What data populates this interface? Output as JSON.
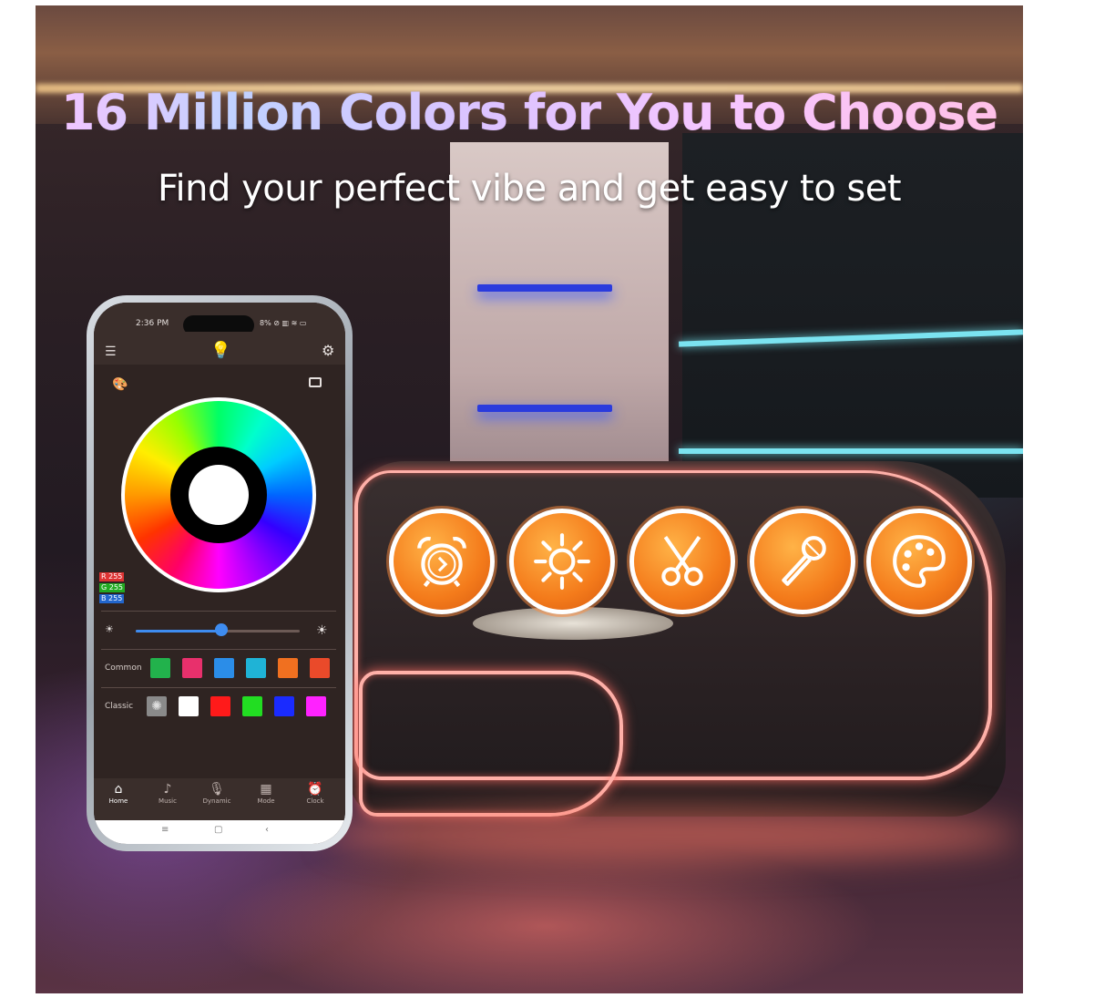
{
  "headline": "16 Million Colors for You to Choose",
  "subheadline": "Find your perfect vibe and get easy to set",
  "feature_icons": [
    "alarm-clock-icon",
    "sun-brightness-icon",
    "scissors-icon",
    "microphone-icon",
    "palette-icon"
  ],
  "phone": {
    "status_time": "2:36 PM",
    "status_icons": "8% ⊘ ▥ ≋ ▭",
    "rgb": {
      "r": "R 255",
      "g": "G 255",
      "b": "B 255"
    },
    "brightness_percent": 52,
    "rows": {
      "common_label": "Common",
      "common_colors": [
        "#22b24c",
        "#e8306c",
        "#2b8de8",
        "#1fb3d6",
        "#f07020",
        "#ea4a2a"
      ],
      "classic_label": "Classic",
      "classic_colors": [
        "#ffffff",
        "#ff1a1a",
        "#22dd22",
        "#1a2bff",
        "#ff22ff"
      ]
    },
    "nav": [
      {
        "icon": "home-icon",
        "label": "Home"
      },
      {
        "icon": "music-icon",
        "label": "Music"
      },
      {
        "icon": "mic-icon",
        "label": "Dynamic"
      },
      {
        "icon": "mode-icon",
        "label": "Mode"
      },
      {
        "icon": "clock-icon",
        "label": "Clock"
      }
    ]
  }
}
